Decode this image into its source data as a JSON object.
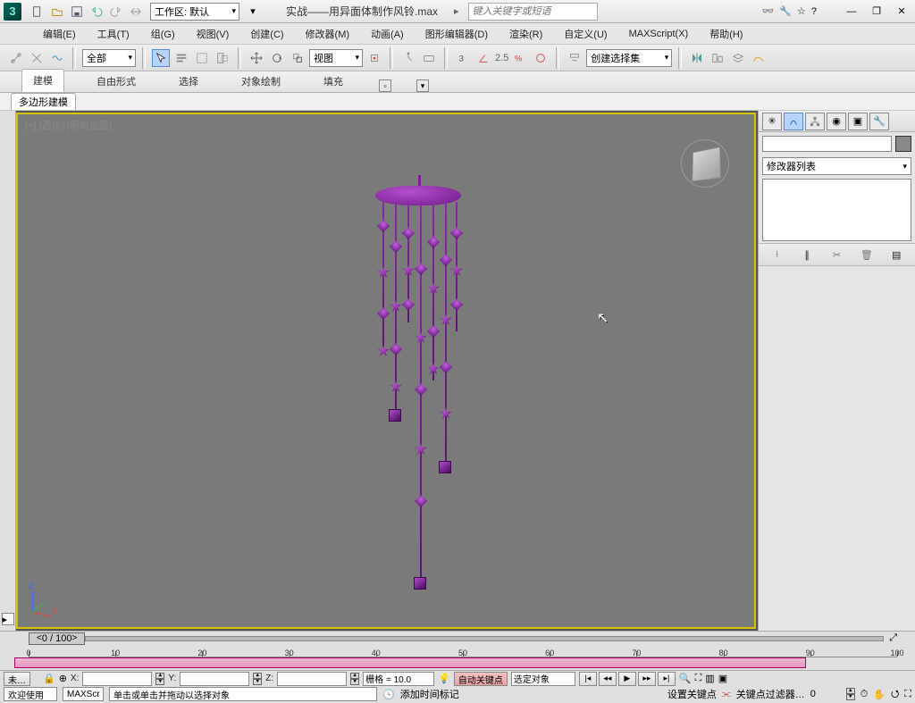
{
  "titlebar": {
    "workspace_label": "工作区: 默认",
    "doc_title": "实战——用异面体制作风铃.max",
    "search_placeholder": "键入关键字或短语",
    "arrow_icon_right": "▸",
    "win_min": "—",
    "win_restore": "❐",
    "win_close": "✕"
  },
  "menu": {
    "items": [
      {
        "label": "编辑(E)"
      },
      {
        "label": "工具(T)"
      },
      {
        "label": "组(G)"
      },
      {
        "label": "视图(V)"
      },
      {
        "label": "创建(C)"
      },
      {
        "label": "修改器(M)"
      },
      {
        "label": "动画(A)"
      },
      {
        "label": "图形编辑器(D)"
      },
      {
        "label": "渲染(R)"
      },
      {
        "label": "自定义(U)"
      },
      {
        "label": "MAXScript(X)"
      },
      {
        "label": "帮助(H)"
      }
    ]
  },
  "toolbar": {
    "filter_label": "全部",
    "ref_label": "视图",
    "snap_angle": "2.5",
    "named_set_label": "创建选择集"
  },
  "ribbon": {
    "tabs": [
      {
        "label": "建模"
      },
      {
        "label": "自由形式"
      },
      {
        "label": "选择"
      },
      {
        "label": "对象绘制"
      },
      {
        "label": "填充"
      }
    ],
    "subtab": "多边形建模"
  },
  "viewport": {
    "prefix": "[+]",
    "view_name": "[透视]",
    "shade_name": "[明暗处理]",
    "axis": {
      "z": "z",
      "x": "x"
    }
  },
  "cmdpanel": {
    "modifier_list_label": "修改器列表"
  },
  "timeline": {
    "frame_display": "0 / 100",
    "ticks": [
      0,
      10,
      20,
      30,
      40,
      50,
      60,
      70,
      80,
      90,
      100
    ]
  },
  "status": {
    "sel_label": "未…",
    "x_label": "X:",
    "y_label": "Y:",
    "z_label": "Z:",
    "grid_label": "栅格 = 10.0",
    "autokey": "自动关键点",
    "selected": "选定对象",
    "add_marker": "添加时间标记",
    "setkey": "设置关键点",
    "keyfilter": "关键点过滤器…",
    "welcome": "欢迎使用",
    "maxscr": "MAXScr",
    "hint": "单击或单击并拖动以选择对象"
  }
}
